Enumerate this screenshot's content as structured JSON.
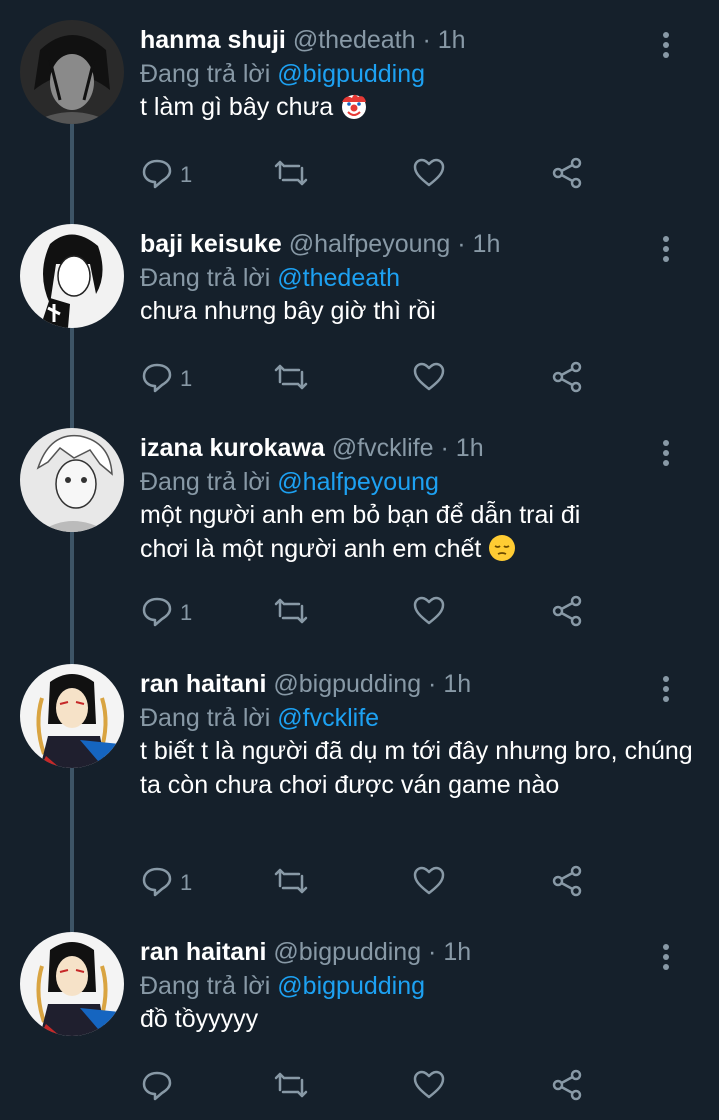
{
  "reply_prefix": "Đang trả lời",
  "tweets": [
    {
      "name": "hanma shuji",
      "handle": "@thedeath",
      "dot": "·",
      "time": "1h",
      "reply_to": "@bigpudding",
      "text": "t làm gì bây chưa",
      "emoji": "clown-face",
      "reply_count": "1"
    },
    {
      "name": "baji keisuke",
      "handle": "@halfpeyoung",
      "dot": "·",
      "time": "1h",
      "reply_to": "@thedeath",
      "text": "chưa nhưng bây giờ thì rồi",
      "reply_count": "1"
    },
    {
      "name": "izana kurokawa",
      "handle": "@fvcklife",
      "dot": "·",
      "time": "1h",
      "reply_to": "@halfpeyoung",
      "text_line1": "một người anh em bỏ bạn để dẫn trai đi",
      "text_line2": "chơi là một người anh em chết",
      "emoji": "pensive-face",
      "reply_count": "1"
    },
    {
      "name": "ran haitani",
      "handle": "@bigpudding",
      "dot": "·",
      "time": "1h",
      "reply_to": "@fvcklife",
      "text": "t biết t là người đã dụ m tới đây nhưng bro, chúng ta còn chưa chơi được ván game nào",
      "reply_count": "1"
    },
    {
      "name": "ran haitani",
      "handle": "@bigpudding",
      "dot": "·",
      "time": "1h",
      "reply_to": "@bigpudding",
      "text": "đồ tồyyyyy",
      "reply_count": ""
    }
  ],
  "colors": {
    "background": "#15202b",
    "secondary_text": "#8899a6",
    "accent": "#1da1f2",
    "thread_line": "#3d5466"
  },
  "icons": [
    "reply-icon",
    "retweet-icon",
    "like-icon",
    "share-icon",
    "more-icon"
  ]
}
